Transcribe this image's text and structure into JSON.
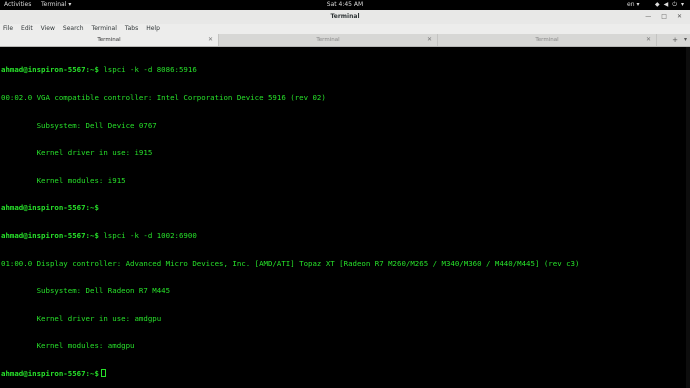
{
  "topbar": {
    "activities": "Activities",
    "app_menu": "Terminal",
    "app_menu_arrow": "▾",
    "clock": "Sat  4:45 AM",
    "lang": "en",
    "lang_arrow": "▾",
    "network_icon": "◆",
    "volume_icon": "◀",
    "power_icon": "⏻",
    "sys_arrow": "▾"
  },
  "window": {
    "title": "Terminal",
    "minimize": "—",
    "maximize": "□",
    "close": "✕"
  },
  "menubar": [
    "File",
    "Edit",
    "View",
    "Search",
    "Terminal",
    "Tabs",
    "Help"
  ],
  "tabs": [
    {
      "label": "Terminal",
      "close": "✕"
    },
    {
      "label": "Terminal",
      "close": "✕"
    },
    {
      "label": "Terminal",
      "close": "✕"
    }
  ],
  "tab_add": "+",
  "tab_menu": "▾",
  "terminal": {
    "lines": [
      {
        "prompt": "ahmad@inspiron-5567:~$",
        "text": " lspci -k -d 8086:5916"
      },
      {
        "prompt": "",
        "text": "00:02.0 VGA compatible controller: Intel Corporation Device 5916 (rev 02)"
      },
      {
        "prompt": "",
        "text": "        Subsystem: Dell Device 0767"
      },
      {
        "prompt": "",
        "text": "        Kernel driver in use: i915"
      },
      {
        "prompt": "",
        "text": "        Kernel modules: i915"
      },
      {
        "prompt": "ahmad@inspiron-5567:~$",
        "text": ""
      },
      {
        "prompt": "ahmad@inspiron-5567:~$",
        "text": " lspci -k -d 1002:6900"
      },
      {
        "prompt": "",
        "text": "01:00.0 Display controller: Advanced Micro Devices, Inc. [AMD/ATI] Topaz XT [Radeon R7 M260/M265 / M340/M360 / M440/M445] (rev c3)"
      },
      {
        "prompt": "",
        "text": "        Subsystem: Dell Radeon R7 M445"
      },
      {
        "prompt": "",
        "text": "        Kernel driver in use: amdgpu"
      },
      {
        "prompt": "",
        "text": "        Kernel modules: amdgpu"
      },
      {
        "prompt": "ahmad@inspiron-5567:~$",
        "text": ""
      }
    ]
  },
  "colors": {
    "terminal_fg": "#27e22a",
    "terminal_bg": "#000000",
    "chrome_bg": "#e8e8e7"
  }
}
